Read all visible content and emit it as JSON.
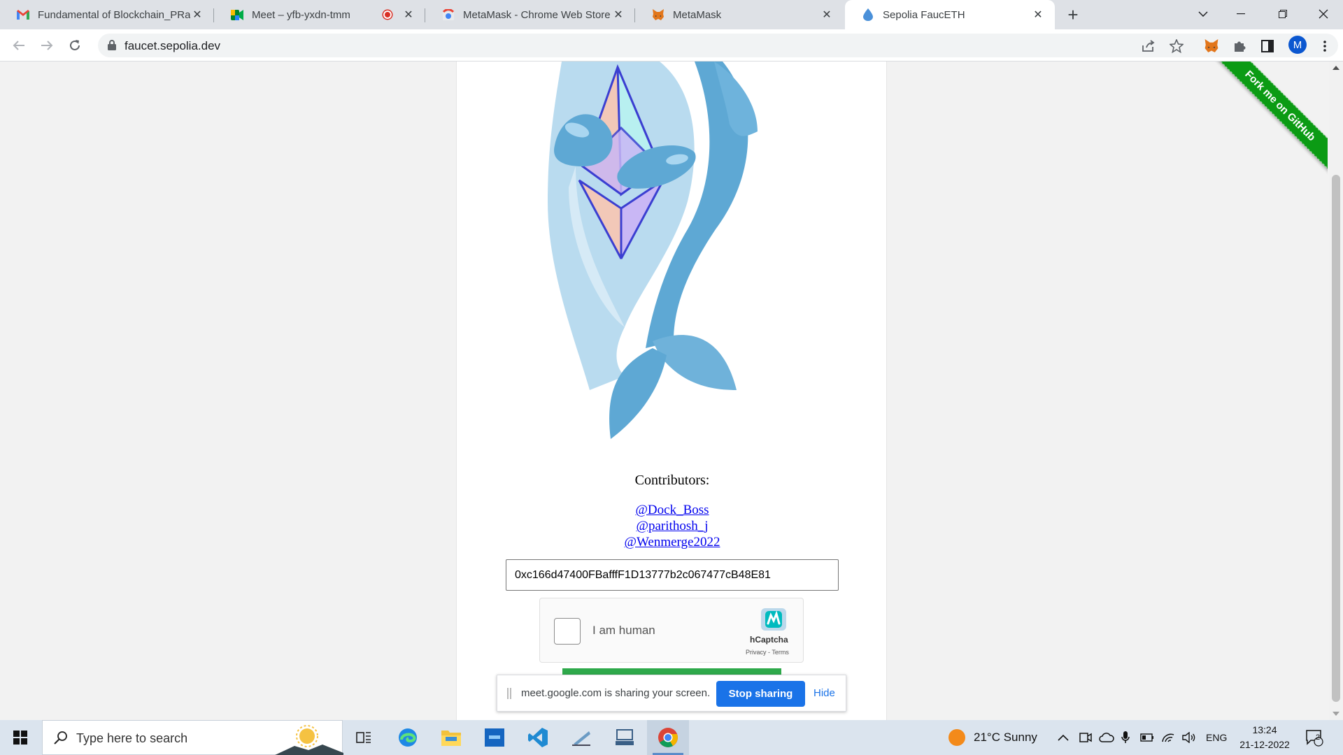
{
  "browser": {
    "tabs": [
      {
        "title": "Fundamental of Blockchain_PRactical",
        "icon": "gmail-icon"
      },
      {
        "title": "Meet – yfb-yxdn-tmm",
        "icon": "meet-icon",
        "recording": true
      },
      {
        "title": "MetaMask - Chrome Web Store",
        "icon": "chrome-web-store-icon"
      },
      {
        "title": "MetaMask",
        "icon": "metamask-fox-icon"
      },
      {
        "title": "Sepolia FaucETH",
        "icon": "water-drop-icon",
        "active": true
      }
    ],
    "url": "faucet.sepolia.dev",
    "profile_initial": "M"
  },
  "page": {
    "contributors_label": "Contributors:",
    "contributors": [
      "@Dock_Boss",
      "@parithosh_j",
      "@Wenmerge2022"
    ],
    "address_value": "0xc166d47400FBafffF1D13777b2c067477cB48E81",
    "captcha": {
      "label": "I am human",
      "brand": "hCaptcha",
      "terms": "Privacy - Terms"
    },
    "ribbon_text": "Fork me on GitHub"
  },
  "share_bar": {
    "message": "meet.google.com is sharing your screen.",
    "stop_label": "Stop sharing",
    "hide_label": "Hide"
  },
  "taskbar": {
    "search_placeholder": "Type here to search",
    "weather": "21°C  Sunny",
    "language": "ENG",
    "time": "13:24",
    "date": "21-12-2022",
    "notification_count": "2"
  },
  "colors": {
    "accent_blue": "#1a73e8",
    "ribbon_green": "#0b9b14",
    "button_green": "#2ea94b",
    "link": "#0000ee"
  }
}
